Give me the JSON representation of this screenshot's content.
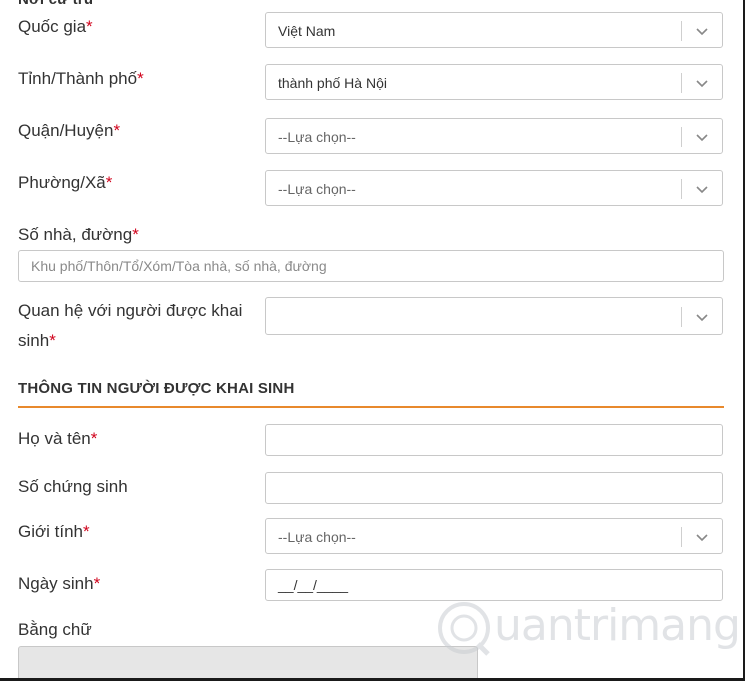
{
  "address_section": {
    "cut_heading": "Nơi cư trú",
    "fields": [
      {
        "label": "Quốc gia",
        "required": "*",
        "value": "Việt Nam"
      },
      {
        "label": "Tỉnh/Thành phố",
        "required": "*",
        "value": "thành phố Hà Nội"
      },
      {
        "label": "Quận/Huyện",
        "required": "*",
        "value": "--Lựa chọn--"
      },
      {
        "label": "Phường/Xã",
        "required": "*",
        "value": "--Lựa chọn--"
      }
    ],
    "street": {
      "label": "Số nhà, đường",
      "required": "*",
      "placeholder": "Khu phố/Thôn/Tổ/Xóm/Tòa nhà, số nhà, đường"
    },
    "relationship": {
      "label_line1": "Quan hệ với người được khai",
      "label_line2": "sinh",
      "required": "*",
      "value": ""
    }
  },
  "person_section": {
    "title": "THÔNG TIN NGƯỜI ĐƯỢC KHAI SINH",
    "full_name": {
      "label": "Họ và tên",
      "required": "*",
      "value": ""
    },
    "birth_cert": {
      "label": "Số chứng sinh",
      "value": ""
    },
    "gender": {
      "label": "Giới tính",
      "required": "*",
      "value": "--Lựa chọn--"
    },
    "dob": {
      "label": "Ngày sinh",
      "required": "*",
      "value": "__/__/____"
    },
    "in_words": {
      "label": "Bằng chữ",
      "value": ""
    }
  },
  "watermark": {
    "text": "uantrimang"
  },
  "colors": {
    "accent": "#e8892c",
    "required": "#d0021b"
  }
}
